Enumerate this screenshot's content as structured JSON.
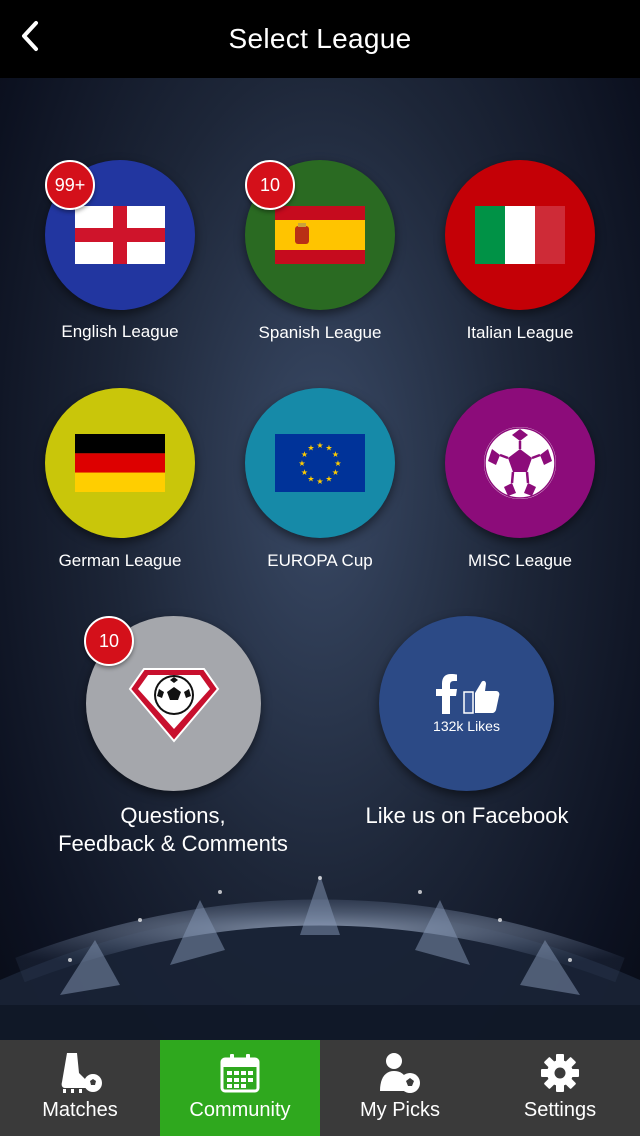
{
  "header": {
    "title": "Select League"
  },
  "leagues": [
    {
      "label": "English League",
      "badge": "99+",
      "color": "#2236a0"
    },
    {
      "label": "Spanish League",
      "badge": "10",
      "color": "#2a6a22"
    },
    {
      "label": "Italian League",
      "badge": "",
      "color": "#c40006"
    },
    {
      "label": "German League",
      "badge": "",
      "color": "#c9c60a"
    },
    {
      "label": "EUROPA Cup",
      "badge": "",
      "color": "#168aa8"
    },
    {
      "label": "MISC League",
      "badge": "",
      "color": "#8c0c7a"
    }
  ],
  "feedback": {
    "label_line1": "Questions,",
    "label_line2": "Feedback & Comments",
    "badge": "10",
    "color": "#a5a7ac"
  },
  "facebook": {
    "label": "Like us on Facebook",
    "likes": "132k Likes",
    "color": "#2c4a86"
  },
  "tabs": [
    {
      "label": "Matches",
      "icon": "cleat-ball-icon",
      "active": false
    },
    {
      "label": "Community",
      "icon": "calendar-icon",
      "active": true
    },
    {
      "label": "My Picks",
      "icon": "user-ball-icon",
      "active": false
    },
    {
      "label": "Settings",
      "icon": "gear-icon",
      "active": false
    }
  ],
  "colors": {
    "tab_active": "#2fa81e",
    "tab_bar": "#3a3a3a",
    "badge": "#d4101a"
  }
}
